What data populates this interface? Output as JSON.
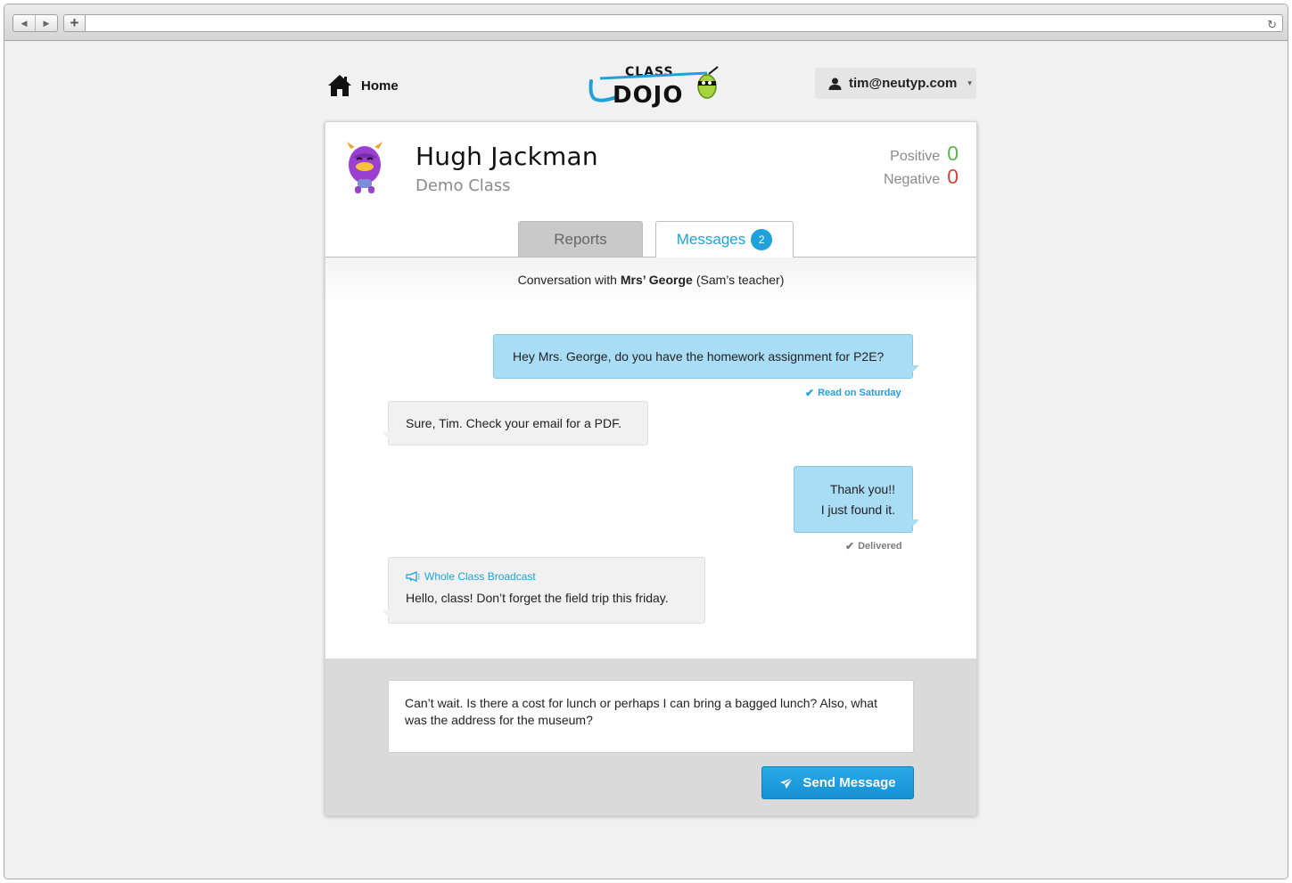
{
  "browser": {
    "back_icon": "◀",
    "forward_icon": "▶",
    "new_tab_icon": "+",
    "url": "",
    "reload_icon": "↻"
  },
  "nav": {
    "home_label": "Home",
    "user_email": "tim@neutyp.com",
    "caret": "▾"
  },
  "logo": {
    "line1": "CLASS",
    "line2": "DOJO"
  },
  "student": {
    "name": "Hugh Jackman",
    "class_name": "Demo Class"
  },
  "points": {
    "positive_label": "Positive",
    "positive_value": "0",
    "negative_label": "Negative",
    "negative_value": "0",
    "positive_color": "#5cb74b",
    "negative_color": "#d1453f"
  },
  "tabs": {
    "reports_label": "Reports",
    "messages_label": "Messages",
    "messages_badge": "2"
  },
  "conversation": {
    "prefix": "Conversation with",
    "contact": "Mrs’ George",
    "suffix": "(Sam’s teacher)"
  },
  "messages": [
    {
      "direction": "out",
      "text": "Hey Mrs. George, do you have the homework assignment for P2E?"
    },
    {
      "direction": "in",
      "text": "Sure, Tim. Check your email for a PDF."
    },
    {
      "direction": "out",
      "line1": "Thank you!!",
      "line2": "I just found it."
    },
    {
      "direction": "in",
      "broadcast_label": "Whole Class Broadcast",
      "text": "Hello, class! Don’t forget the field trip this friday."
    }
  ],
  "statuses": {
    "read": "Read on Saturday",
    "delivered": "Delivered"
  },
  "compose": {
    "value": "Can’t wait. Is there a cost for lunch or perhaps I can bring a bagged lunch? Also, what was the address for the museum?",
    "send_label": "Send Message"
  },
  "colors": {
    "accent": "#1fa1dc",
    "outgoing_bubble": "#a9dcf5",
    "incoming_bubble": "#f1f1f1"
  }
}
